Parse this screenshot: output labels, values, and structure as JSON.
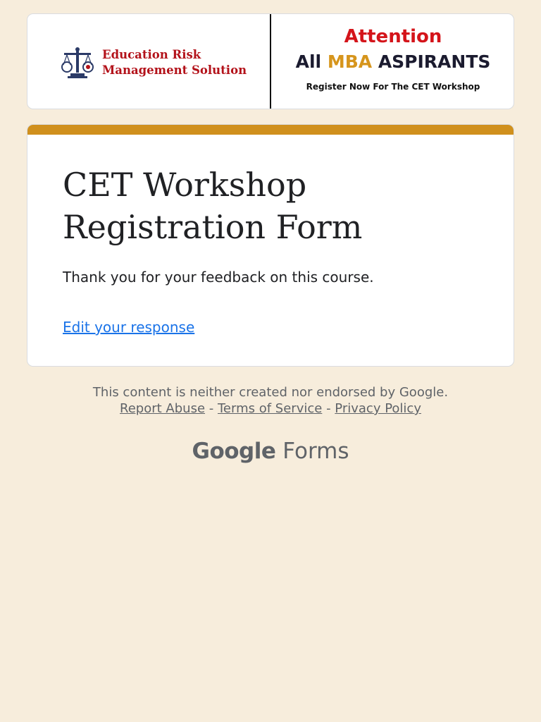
{
  "banner": {
    "brand_name": "Education Risk Management Solution",
    "logo_icon": "scales-of-justice-icon",
    "attention": "Attention",
    "audience_prefix": "All",
    "audience_highlight": "MBA",
    "audience_suffix": "ASPIRANTS",
    "register_text": "Register Now For The CET Workshop"
  },
  "form": {
    "title": "CET Workshop Registration Form",
    "confirmation_message": "Thank you for your feedback on this course.",
    "edit_link": "Edit your response"
  },
  "footer": {
    "disclaimer": "This content is neither created nor endorsed by Google.",
    "links": [
      "Report Abuse",
      "Terms of Service",
      "Privacy Policy"
    ],
    "separator": "-"
  },
  "branding": {
    "google": "Google",
    "forms": "Forms"
  },
  "colors": {
    "background": "#f7eddc",
    "accent": "#d0901d",
    "link": "#1a73e8",
    "brand_red": "#b3121a"
  }
}
